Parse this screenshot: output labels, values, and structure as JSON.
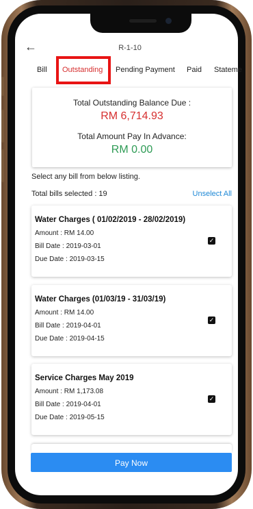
{
  "header": {
    "back_icon": "back-arrow-icon",
    "title": "R-1-10"
  },
  "tabs": [
    {
      "label": "Bill",
      "active": false
    },
    {
      "label": "Outstanding",
      "active": true
    },
    {
      "label": "Pending Payment",
      "active": false
    },
    {
      "label": "Paid",
      "active": false
    },
    {
      "label": "Stateme",
      "active": false
    }
  ],
  "summary": {
    "outstanding_label": "Total Outstanding Balance Due :",
    "outstanding_value": "RM 6,714.93",
    "advance_label": "Total Amount Pay In Advance:",
    "advance_value": "RM 0.00"
  },
  "listing": {
    "hint": "Select any bill from below listing.",
    "total_selected": "Total bills selected : 19",
    "unselect_all": "Unselect All"
  },
  "bills": [
    {
      "title": "Water Charges ( 01/02/2019 - 28/02/2019)",
      "amount": "Amount : RM 14.00",
      "bill_date": "Bill Date : 2019-03-01",
      "due_date": "Due Date : 2019-03-15",
      "checked": true
    },
    {
      "title": "Water Charges (01/03/19 - 31/03/19)",
      "amount": "Amount : RM 14.00",
      "bill_date": "Bill Date : 2019-04-01",
      "due_date": "Due Date : 2019-04-15",
      "checked": true
    },
    {
      "title": "Service Charges May 2019",
      "amount": "Amount : RM 1,173.08",
      "bill_date": "Bill Date : 2019-04-01",
      "due_date": "Due Date : 2019-05-15",
      "checked": true
    }
  ],
  "pay_button": "Pay Now",
  "colors": {
    "outstanding": "#d62f2f",
    "advance": "#2e9b55",
    "link": "#1e88d6",
    "button": "#2b8cf2"
  }
}
